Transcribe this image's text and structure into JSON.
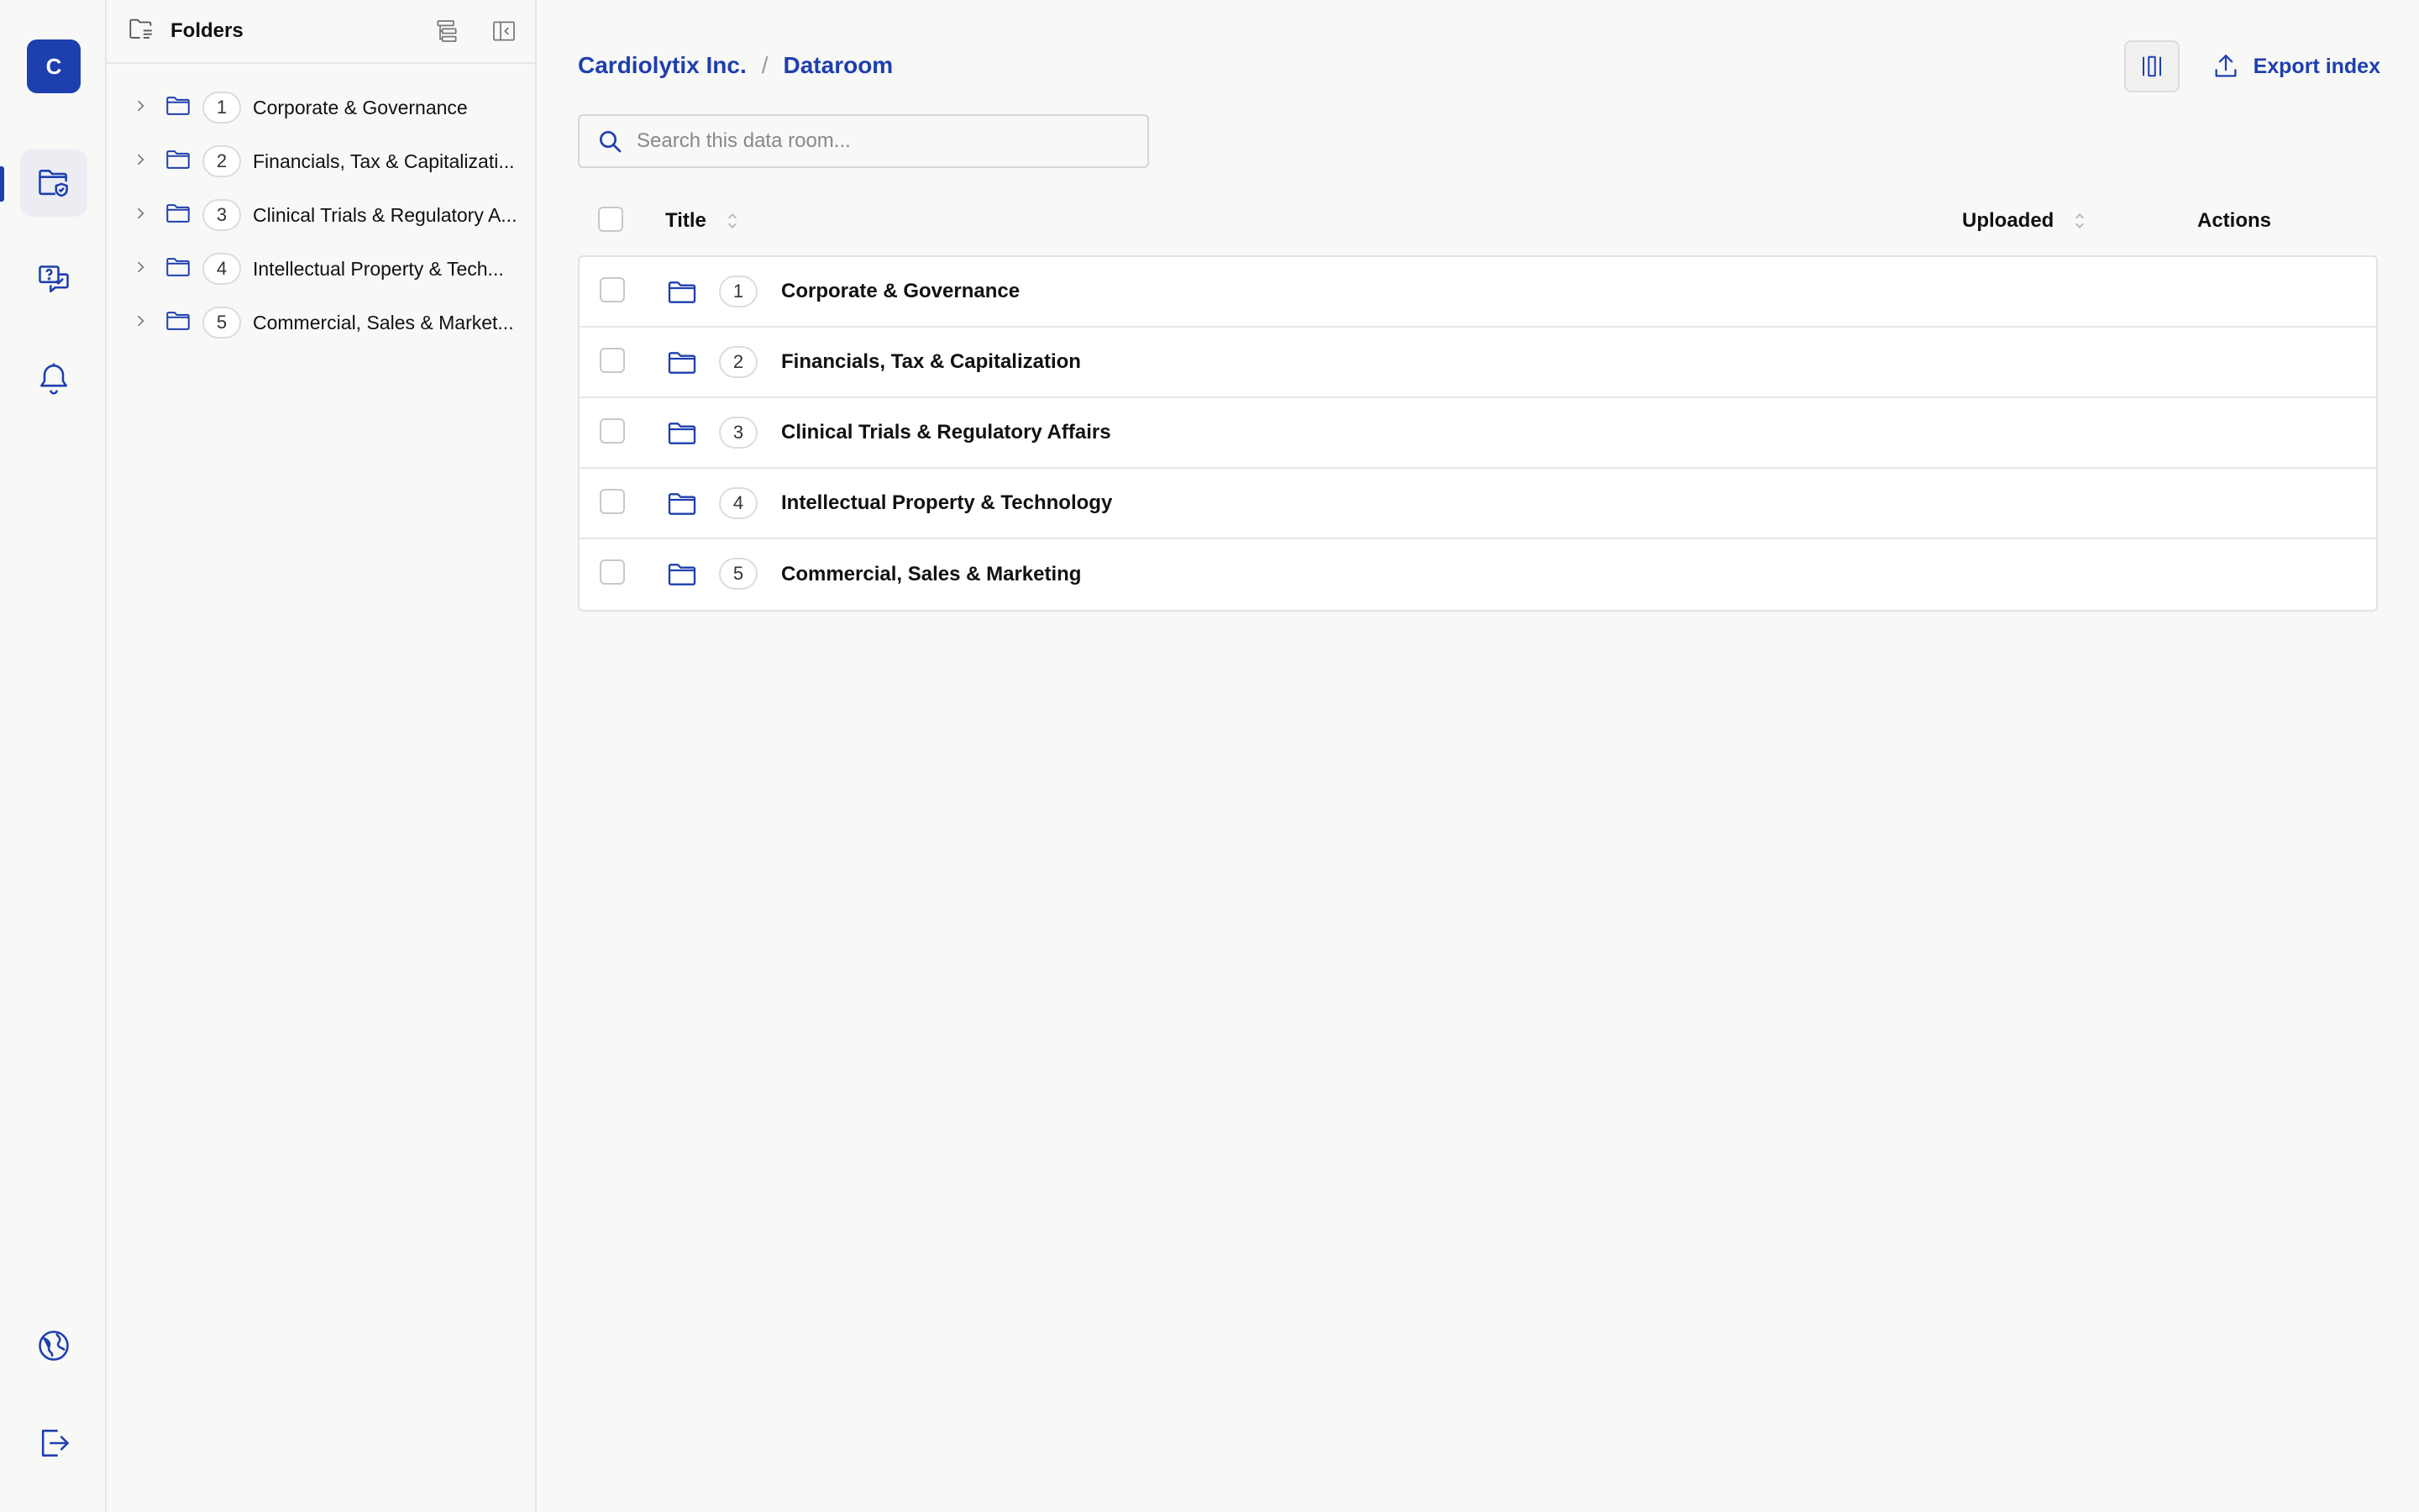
{
  "rail": {
    "avatar_letter": "C",
    "items": [
      {
        "icon": "folder-shield-icon",
        "active": true
      },
      {
        "icon": "qa-checklist-icon",
        "active": false
      },
      {
        "icon": "bell-icon",
        "active": false
      }
    ],
    "bottom": [
      {
        "icon": "globe-icon"
      },
      {
        "icon": "logout-icon"
      }
    ]
  },
  "tree": {
    "title": "Folders",
    "items": [
      {
        "num": "1",
        "label": "Corporate & Governance"
      },
      {
        "num": "2",
        "label": "Financials, Tax & Capitalizati..."
      },
      {
        "num": "3",
        "label": "Clinical Trials & Regulatory A..."
      },
      {
        "num": "4",
        "label": "Intellectual Property & Tech..."
      },
      {
        "num": "5",
        "label": "Commercial, Sales & Market..."
      }
    ]
  },
  "breadcrumb": {
    "company": "Cardiolytix Inc.",
    "separator": "/",
    "current": "Dataroom"
  },
  "actions": {
    "export_label": "Export index"
  },
  "search": {
    "placeholder": "Search this data room..."
  },
  "table": {
    "columns": {
      "title": "Title",
      "uploaded": "Uploaded",
      "actions": "Actions"
    },
    "rows": [
      {
        "num": "1",
        "label": "Corporate & Governance"
      },
      {
        "num": "2",
        "label": "Financials, Tax & Capitalization"
      },
      {
        "num": "3",
        "label": "Clinical Trials & Regulatory Affairs"
      },
      {
        "num": "4",
        "label": "Intellectual Property & Technology"
      },
      {
        "num": "5",
        "label": "Commercial, Sales & Marketing"
      }
    ]
  },
  "colors": {
    "accent": "#1e3fae",
    "background": "#f8f8f7",
    "border": "#e6e6e4"
  }
}
